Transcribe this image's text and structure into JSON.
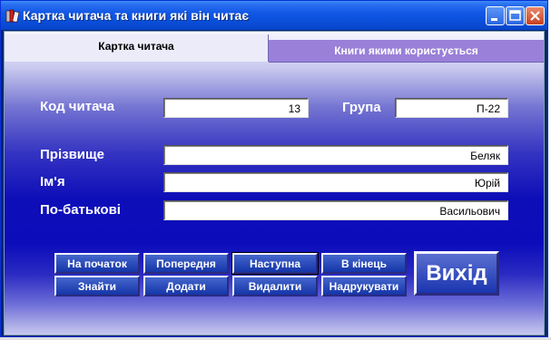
{
  "window": {
    "title": "Картка читача та книги які він читає",
    "title_bar_color": "#0a4fd9"
  },
  "tabs": [
    {
      "label": "Картка читача",
      "active": true
    },
    {
      "label": "Книги якими користується",
      "active": false
    }
  ],
  "form": {
    "code_label": "Код читача",
    "code_value": "13",
    "group_label": "Група",
    "group_value": "П-22",
    "surname_label": "Прізвище",
    "surname_value": "Беляк",
    "name_label": "Ім'я",
    "name_value": "Юрій",
    "patronymic_label": "По-батькові",
    "patronymic_value": "Васильович"
  },
  "buttons": {
    "first": "На початок",
    "prev": "Попередня",
    "next": "Наступна",
    "last": "В кінець",
    "find": "Знайти",
    "add": "Додати",
    "delete": "Видалити",
    "print": "Надрукувати",
    "exit": "Вихід"
  },
  "icons": {
    "app": "books-icon",
    "minimize": "minimize-icon",
    "maximize": "maximize-icon",
    "close": "close-icon"
  }
}
